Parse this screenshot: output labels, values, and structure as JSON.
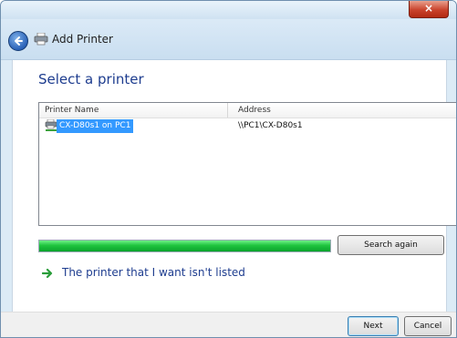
{
  "window": {
    "close_glyph": "×"
  },
  "nav": {
    "title": "Add Printer",
    "back_icon": "back-arrow-icon",
    "printer_icon": "printer-icon"
  },
  "content": {
    "heading": "Select a printer",
    "list": {
      "columns": [
        "Printer Name",
        "Address"
      ],
      "rows": [
        {
          "name": "CX-D80s1 on PC1",
          "address": "\\\\PC1\\CX-D80s1",
          "selected": true
        }
      ]
    },
    "progress": {
      "percent": 100
    },
    "search_button": "Search again",
    "link_text": "The printer that I want isn't listed"
  },
  "footer": {
    "next_label": "Next",
    "cancel_label": "Cancel"
  },
  "colors": {
    "accent": "#1e3d8f",
    "selection": "#3399ff",
    "progress": "#1fc43e"
  }
}
